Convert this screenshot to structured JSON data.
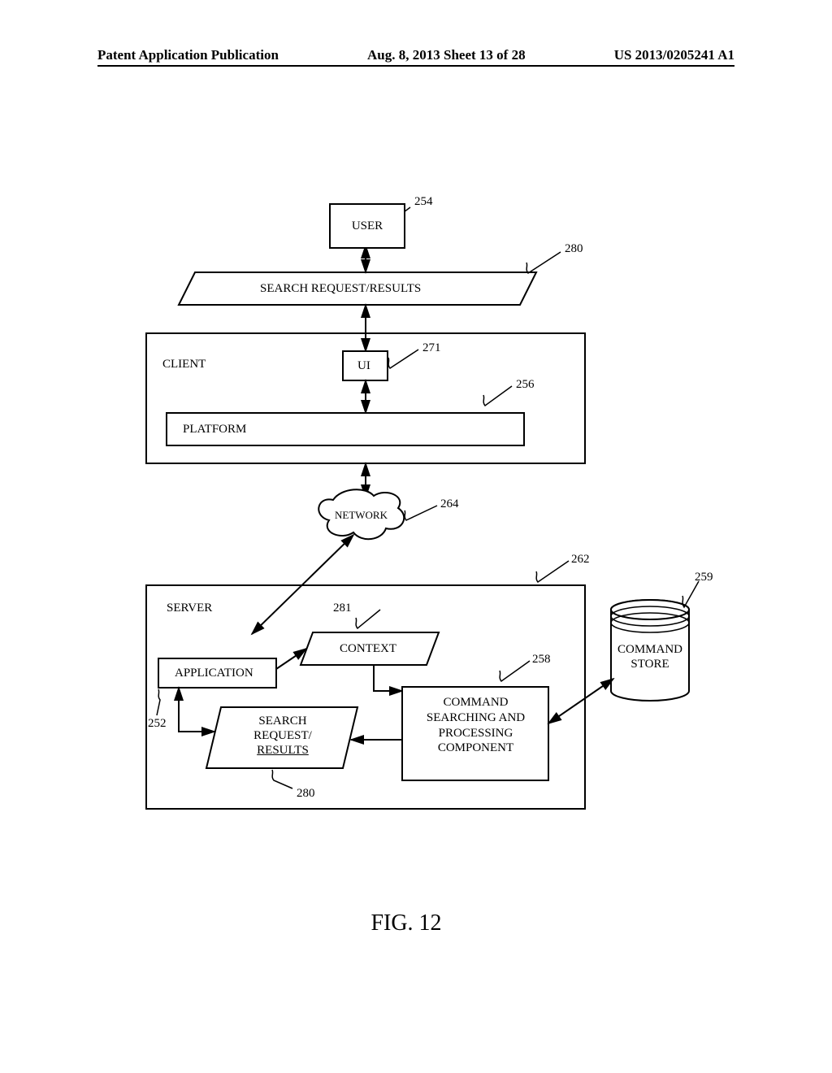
{
  "header": {
    "left": "Patent Application Publication",
    "center": "Aug. 8, 2013   Sheet 13 of 28",
    "right": "US 2013/0205241 A1"
  },
  "diagram": {
    "user": {
      "label": "USER",
      "ref": "254"
    },
    "search_request_results_top": {
      "label": "SEARCH REQUEST/RESULTS",
      "ref": "280"
    },
    "client": {
      "label": "CLIENT"
    },
    "ui": {
      "label": "UI",
      "ref": "271"
    },
    "platform": {
      "label": "PLATFORM",
      "ref": "256"
    },
    "network": {
      "label": "NETWORK",
      "ref": "264"
    },
    "server": {
      "label": "SERVER",
      "ref": "262"
    },
    "context": {
      "label": "CONTEXT",
      "ref": "281"
    },
    "application": {
      "label": "APPLICATION",
      "ref": "252"
    },
    "search_request_results_bottom": {
      "label": "SEARCH REQUEST/ RESULTS",
      "ref": "280"
    },
    "command_searching": {
      "label": "COMMAND SEARCHING AND PROCESSING COMPONENT",
      "ref": "258"
    },
    "command_store": {
      "label": "COMMAND STORE",
      "ref": "259"
    }
  },
  "figure_caption": "FIG. 12"
}
